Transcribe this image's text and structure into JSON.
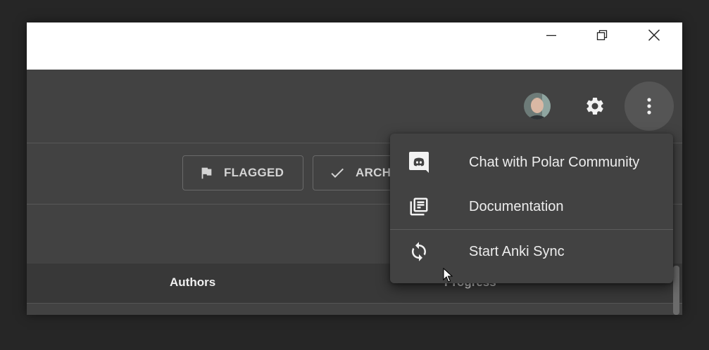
{
  "window": {
    "controls": [
      "minimize-icon",
      "restore-icon",
      "close-icon"
    ]
  },
  "appbar": {
    "icons": [
      "avatar",
      "gear-icon",
      "more-vert-icon"
    ]
  },
  "filters": {
    "flagged_label": "FLAGGED",
    "archived_label": "ARCH"
  },
  "table": {
    "headers": {
      "authors": "Authors",
      "progress": "Progress"
    }
  },
  "menu": {
    "items": [
      {
        "label": "Chat with Polar Community",
        "icon": "discord-icon"
      },
      {
        "label": "Documentation",
        "icon": "library-books-icon"
      },
      {
        "label": "Start Anki Sync",
        "icon": "sync-icon"
      }
    ]
  },
  "colors": {
    "app_background": "#424242",
    "table_header": "#383838",
    "menu_background": "#424242",
    "titlebar": "#ffffff",
    "desktop": "#262626"
  }
}
